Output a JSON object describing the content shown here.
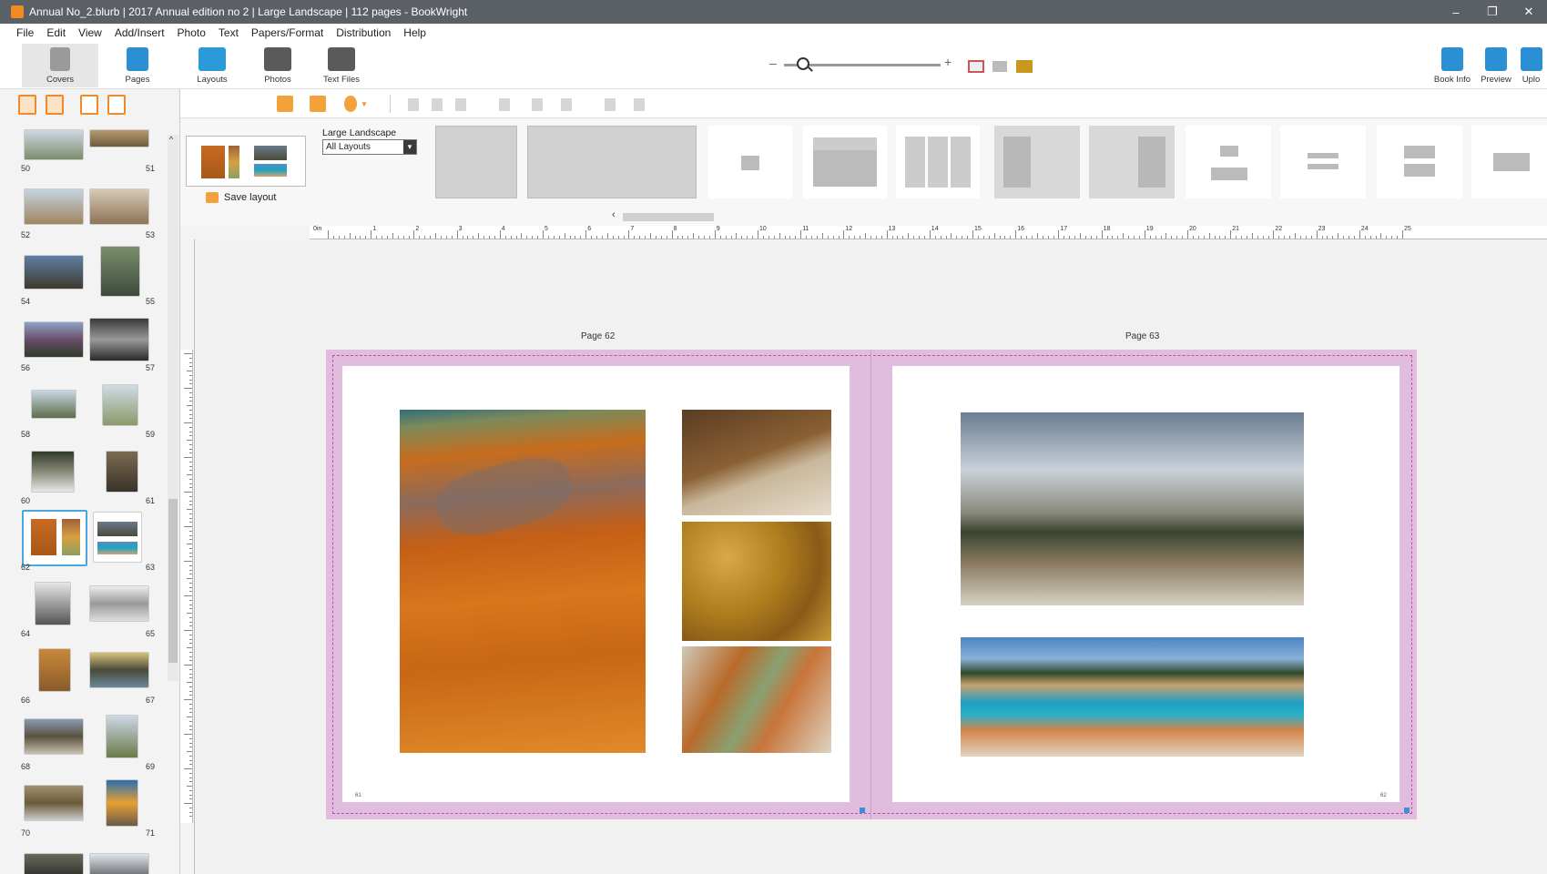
{
  "window": {
    "title": "Annual No_2.blurb | 2017 Annual edition no 2 | Large Landscape | 112 pages - BookWright"
  },
  "menu": [
    "File",
    "Edit",
    "View",
    "Add/Insert",
    "Photo",
    "Text",
    "Papers/Format",
    "Distribution",
    "Help"
  ],
  "left_tabs": {
    "covers": "Covers",
    "pages": "Pages"
  },
  "toolbar": {
    "layouts": "Layouts",
    "photos": "Photos",
    "text_files": "Text Files",
    "book_info": "Book Info",
    "preview": "Preview",
    "upload": "Uplo"
  },
  "layout_panel": {
    "format_label": "Large Landscape",
    "filter_value": "All Layouts",
    "save_label": "Save layout"
  },
  "page_numbers": [
    "50",
    "51",
    "52",
    "53",
    "54",
    "55",
    "56",
    "57",
    "58",
    "59",
    "60",
    "61",
    "62",
    "63",
    "64",
    "65",
    "66",
    "67",
    "68",
    "69",
    "70",
    "71"
  ],
  "ruler": {
    "unit": "0in",
    "marks": [
      "1",
      "2",
      "3",
      "4",
      "5",
      "6",
      "7",
      "8",
      "9",
      "10",
      "11",
      "12",
      "13",
      "14",
      "15",
      "16",
      "17",
      "18",
      "19",
      "20",
      "21",
      "22",
      "23",
      "24",
      "25"
    ]
  },
  "spread": {
    "left_title": "Page 62",
    "right_title": "Page 63",
    "left_folio": "61",
    "right_folio": "62"
  },
  "colors": {
    "accent": "#f08a24",
    "selection": "#4aa7e0",
    "bleed": "#e0bddf",
    "titlebar": "#5b6066"
  }
}
